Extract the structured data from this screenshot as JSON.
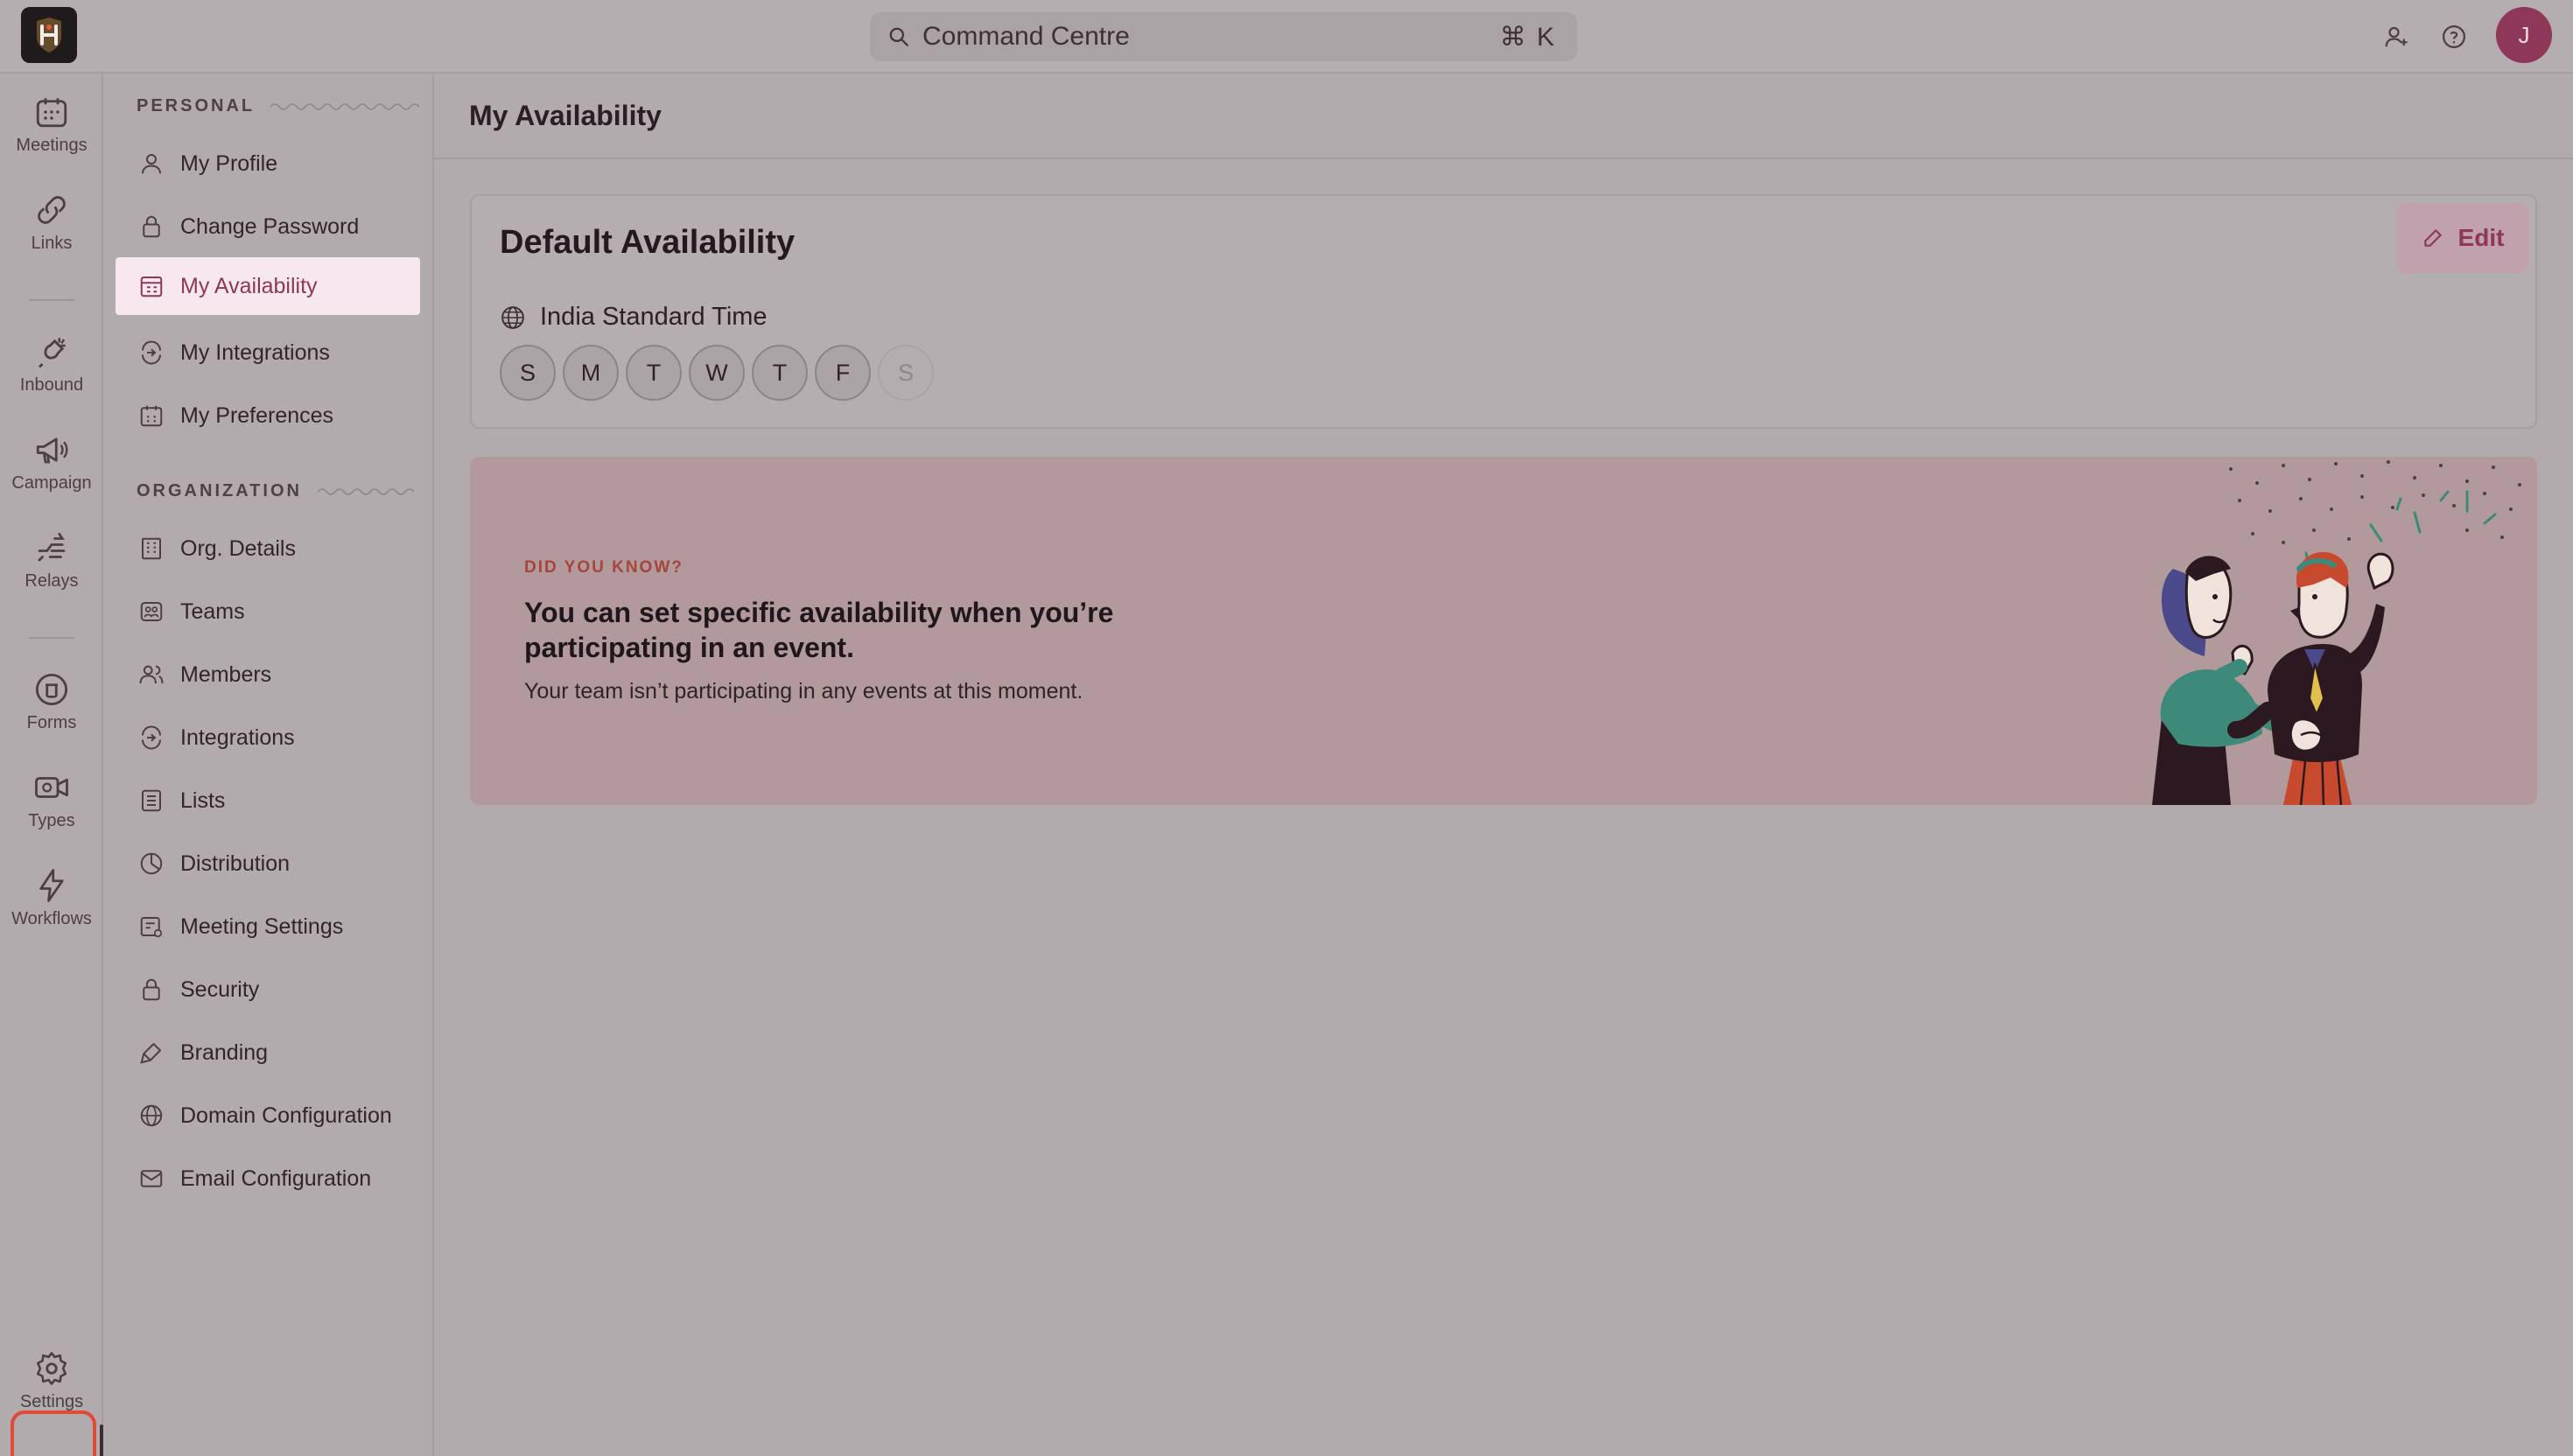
{
  "app": {
    "logo_icon": "app-logo",
    "accent_color": "#8e3758"
  },
  "topbar": {
    "search_label": "Command Centre",
    "search_shortcut": "⌘ K",
    "avatar_initial": "J",
    "icons": [
      "search-icon",
      "add-user-icon",
      "help-icon"
    ]
  },
  "rail": {
    "items": [
      {
        "label": "Meetings",
        "icon": "calendar-icon"
      },
      {
        "label": "Links",
        "icon": "link-icon"
      },
      {
        "label": "Inbound",
        "icon": "inbound-icon"
      },
      {
        "label": "Campaign",
        "icon": "megaphone-icon"
      },
      {
        "label": "Relays",
        "icon": "relay-icon"
      },
      {
        "label": "Forms",
        "icon": "forms-icon"
      },
      {
        "label": "Types",
        "icon": "video-icon"
      },
      {
        "label": "Workflows",
        "icon": "lightning-icon"
      },
      {
        "label": "Settings",
        "icon": "gear-icon"
      }
    ]
  },
  "menu": {
    "personal_title": "PERSONAL",
    "organization_title": "ORGANIZATION",
    "personal": [
      {
        "label": "My Profile",
        "icon": "user-icon"
      },
      {
        "label": "Change Password",
        "icon": "lock-icon"
      },
      {
        "label": "My Availability",
        "icon": "calendar-grid-icon",
        "active": true
      },
      {
        "label": "My Integrations",
        "icon": "integrations-icon"
      },
      {
        "label": "My Preferences",
        "icon": "preferences-icon"
      }
    ],
    "organization": [
      {
        "label": "Org. Details",
        "icon": "building-icon"
      },
      {
        "label": "Teams",
        "icon": "teams-icon"
      },
      {
        "label": "Members",
        "icon": "members-icon"
      },
      {
        "label": "Integrations",
        "icon": "integrations-icon"
      },
      {
        "label": "Lists",
        "icon": "list-icon"
      },
      {
        "label": "Distribution",
        "icon": "pie-icon"
      },
      {
        "label": "Meeting Settings",
        "icon": "meeting-settings-icon"
      },
      {
        "label": "Security",
        "icon": "lock-icon"
      },
      {
        "label": "Branding",
        "icon": "brush-icon"
      },
      {
        "label": "Domain Configuration",
        "icon": "globe-icon"
      },
      {
        "label": "Email Configuration",
        "icon": "mail-icon"
      }
    ]
  },
  "main": {
    "page_title": "My Availability",
    "card": {
      "title": "Default Availability",
      "edit_label": "Edit",
      "timezone": "India Standard Time",
      "days": [
        {
          "label": "S",
          "enabled": true
        },
        {
          "label": "M",
          "enabled": true
        },
        {
          "label": "T",
          "enabled": true
        },
        {
          "label": "W",
          "enabled": true
        },
        {
          "label": "T",
          "enabled": true
        },
        {
          "label": "F",
          "enabled": true
        },
        {
          "label": "S",
          "enabled": false
        }
      ]
    },
    "did_you_know": {
      "eyebrow": "DID YOU KNOW?",
      "title": "You can set specific availability when you’re participating in an event.",
      "subtitle": "Your team isn’t participating in any events at this moment.",
      "illustration": "handshake-illustration"
    }
  }
}
